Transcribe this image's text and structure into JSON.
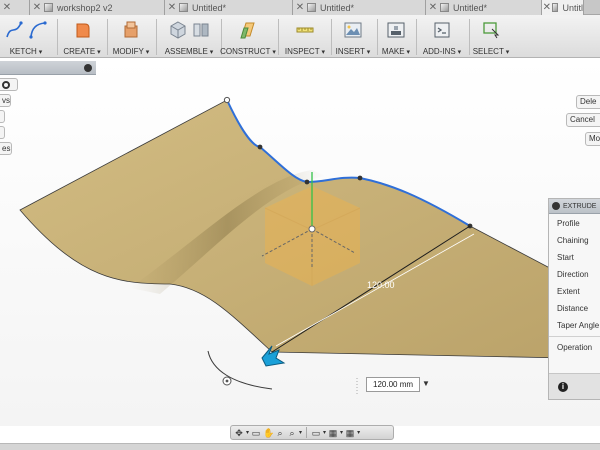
{
  "tabs": [
    {
      "label": "",
      "active": false
    },
    {
      "label": "workshop2 v2",
      "active": false
    },
    {
      "label": "Untitled*",
      "active": false
    },
    {
      "label": "Untitled*",
      "active": false
    },
    {
      "label": "Untitled*",
      "active": false
    },
    {
      "label": "Untitled*",
      "active": false
    },
    {
      "label": "Untitl",
      "active": true
    }
  ],
  "toolbar": {
    "sketch": "KETCH",
    "create": "CREATE",
    "modify": "MODIFY",
    "assemble": "ASSEMBLE",
    "construct": "CONSTRUCT",
    "inspect": "INSPECT",
    "insert": "INSERT",
    "make": "MAKE",
    "addins": "ADD-INS",
    "select": "SELECT"
  },
  "left_buttons": [
    "vs",
    "",
    "",
    "es"
  ],
  "right_buttons": [
    "Dele",
    "Cancel",
    "Mo"
  ],
  "extrude": {
    "title": "EXTRUDE",
    "rows": [
      "Profile",
      "Chaining",
      "Start",
      "Direction",
      "Extent",
      "Distance",
      "Taper Angle",
      "Operation"
    ],
    "info_icon": "i"
  },
  "dimension_label": "120.00",
  "distance_input": "120.00 mm",
  "colors": {
    "surface": "#c9b276",
    "edge_highlight": "#2f6fd8",
    "toolbar_bg": "#e6e6e6",
    "arrow": "#1aa0d8"
  }
}
